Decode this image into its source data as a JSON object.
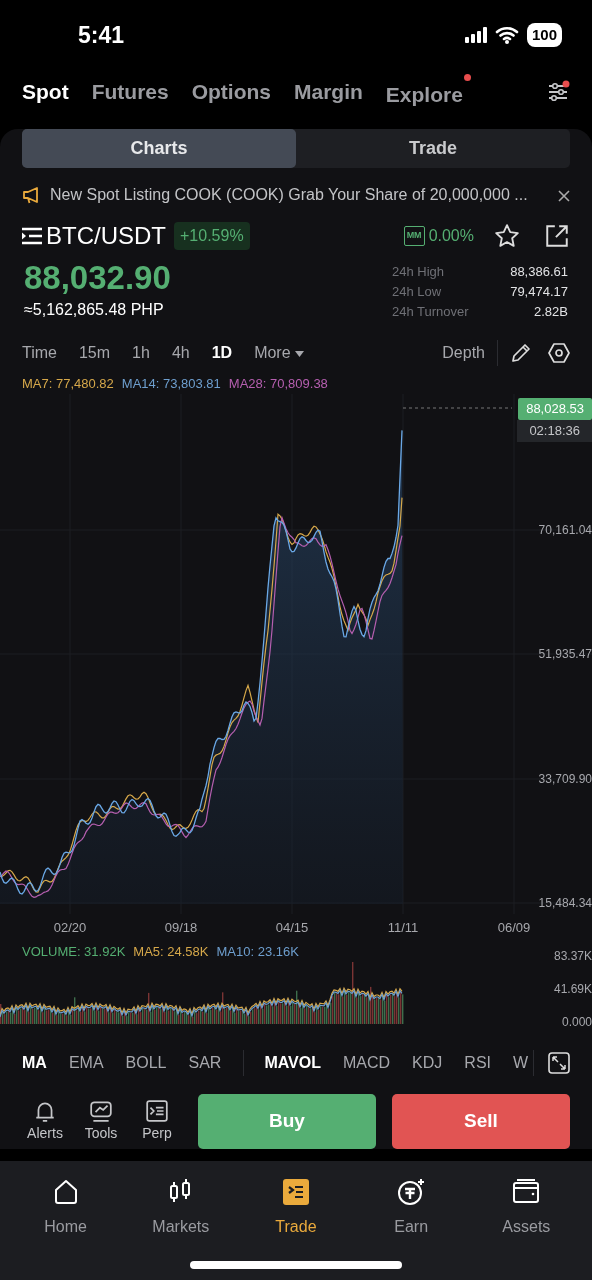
{
  "status_bar": {
    "time": "5:41",
    "battery": "100"
  },
  "top_tabs": [
    {
      "label": "Spot",
      "selected": true,
      "dot": false
    },
    {
      "label": "Futures",
      "selected": false,
      "dot": false
    },
    {
      "label": "Options",
      "selected": false,
      "dot": false
    },
    {
      "label": "Margin",
      "selected": false,
      "dot": false
    },
    {
      "label": "Explore",
      "selected": false,
      "dot": true
    }
  ],
  "settings_dot": true,
  "view_tabs": [
    {
      "label": "Charts",
      "selected": true
    },
    {
      "label": "Trade",
      "selected": false
    }
  ],
  "announcement": "New Spot Listing  COOK (COOK)  Grab Your Share of 20,000,000 ...",
  "pair": {
    "symbol": "BTC/USDT",
    "change": "+10.59%",
    "mm_label": "MM",
    "mm_value": "0.00%",
    "favorite": false
  },
  "price": {
    "last": "88,032.90",
    "fiat": "≈5,162,865.48 PHP"
  },
  "stats": [
    {
      "label": "24h High",
      "value": "88,386.61"
    },
    {
      "label": "24h Low",
      "value": "79,474.17"
    },
    {
      "label": "24h Turnover",
      "value": "2.82B"
    }
  ],
  "intervals": [
    {
      "label": "Time",
      "selected": false
    },
    {
      "label": "15m",
      "selected": false
    },
    {
      "label": "1h",
      "selected": false
    },
    {
      "label": "4h",
      "selected": false
    },
    {
      "label": "1D",
      "selected": true
    },
    {
      "label": "More",
      "selected": false
    }
  ],
  "depth": "Depth",
  "ma_legend": [
    {
      "label": "MA7: 77,480.82",
      "color": "#d6a84a"
    },
    {
      "label": "MA14: 73,803.81",
      "color": "#6e9fcf"
    },
    {
      "label": "MA28: 70,809.38",
      "color": "#b65fb0"
    }
  ],
  "chart": {
    "price_tag": "88,028.53",
    "countdown": "02:18:36",
    "y_labels": [
      "70,161.04",
      "51,935.47",
      "33,709.90",
      "15,484.34"
    ],
    "x_labels": [
      "02/20",
      "09/18",
      "04/15",
      "11/11",
      "06/09"
    ]
  },
  "volume": {
    "legend": [
      {
        "label": "VOLUME: 31.92K",
        "color": "#55af72"
      },
      {
        "label": "MA5: 24.58K",
        "color": "#d6a84a"
      },
      {
        "label": "MA10: 23.16K",
        "color": "#6e9fcf"
      }
    ],
    "y_labels": [
      "83.37K",
      "41.69K",
      "0.000"
    ]
  },
  "indicators_main": [
    {
      "label": "MA",
      "selected": true
    },
    {
      "label": "EMA",
      "selected": false
    },
    {
      "label": "BOLL",
      "selected": false
    },
    {
      "label": "SAR",
      "selected": false
    }
  ],
  "indicators_sub": [
    {
      "label": "MAVOL",
      "selected": true
    },
    {
      "label": "MACD",
      "selected": false
    },
    {
      "label": "KDJ",
      "selected": false
    },
    {
      "label": "RSI",
      "selected": false
    },
    {
      "label": "W",
      "selected": false
    }
  ],
  "actions": [
    {
      "label": "Alerts",
      "kind": "bell"
    },
    {
      "label": "Tools",
      "kind": "chart"
    },
    {
      "label": "Perp",
      "kind": "perp"
    }
  ],
  "buy": "Buy",
  "sell": "Sell",
  "nav": [
    {
      "label": "Home",
      "kind": "home",
      "selected": false
    },
    {
      "label": "Markets",
      "kind": "candles",
      "selected": false
    },
    {
      "label": "Trade",
      "kind": "trade",
      "selected": true
    },
    {
      "label": "Earn",
      "kind": "earn",
      "selected": false
    },
    {
      "label": "Assets",
      "kind": "wallet",
      "selected": false
    }
  ]
}
